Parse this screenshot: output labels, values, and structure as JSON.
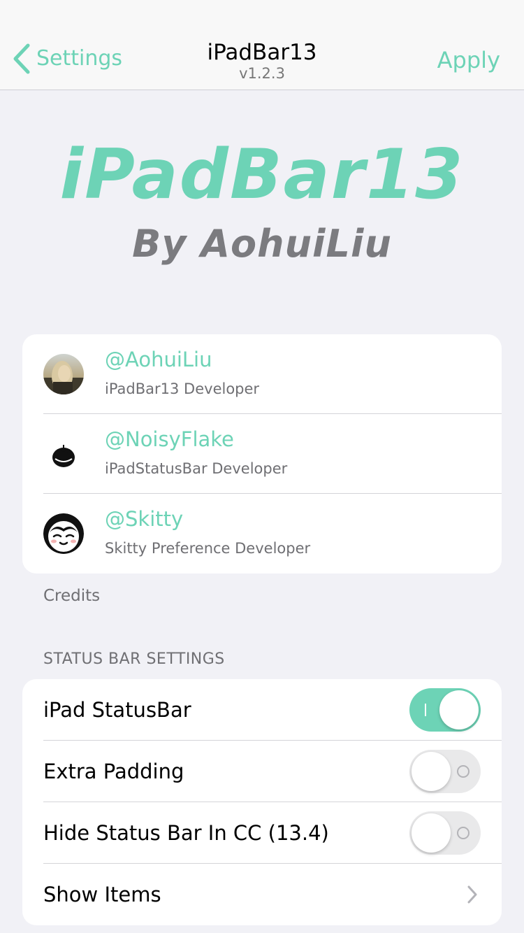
{
  "nav": {
    "back_label": "Settings",
    "title": "iPadBar13",
    "subtitle": "v1.2.3",
    "action_label": "Apply"
  },
  "hero": {
    "title": "iPadBar13",
    "subtitle": "By AohuiLiu"
  },
  "credits": {
    "items": [
      {
        "handle": "@AohuiLiu",
        "role": "iPadBar13 Developer",
        "avatar_icon": "profile-photo"
      },
      {
        "handle": "@NoisyFlake",
        "role": "iPadStatusBar Developer",
        "avatar_icon": "tomato-icon"
      },
      {
        "handle": "@Skitty",
        "role": "Skitty Preference Developer",
        "avatar_icon": "skitty-face-icon"
      }
    ],
    "footer": "Credits"
  },
  "status_bar_settings": {
    "header": "STATUS BAR SETTINGS",
    "items": [
      {
        "label": "iPad StatusBar",
        "type": "toggle",
        "on": true
      },
      {
        "label": "Extra Padding",
        "type": "toggle",
        "on": false
      },
      {
        "label": "Hide Status Bar In CC (13.4)",
        "type": "toggle",
        "on": false
      },
      {
        "label": "Show Items",
        "type": "link",
        "icon": "chevron-right-icon"
      }
    ]
  },
  "colors": {
    "accent": "#6dd3b6",
    "background": "#f1f1f6",
    "card": "#ffffff",
    "secondary_text": "#6f6f73",
    "toggle_off": "#e9e9ea"
  }
}
